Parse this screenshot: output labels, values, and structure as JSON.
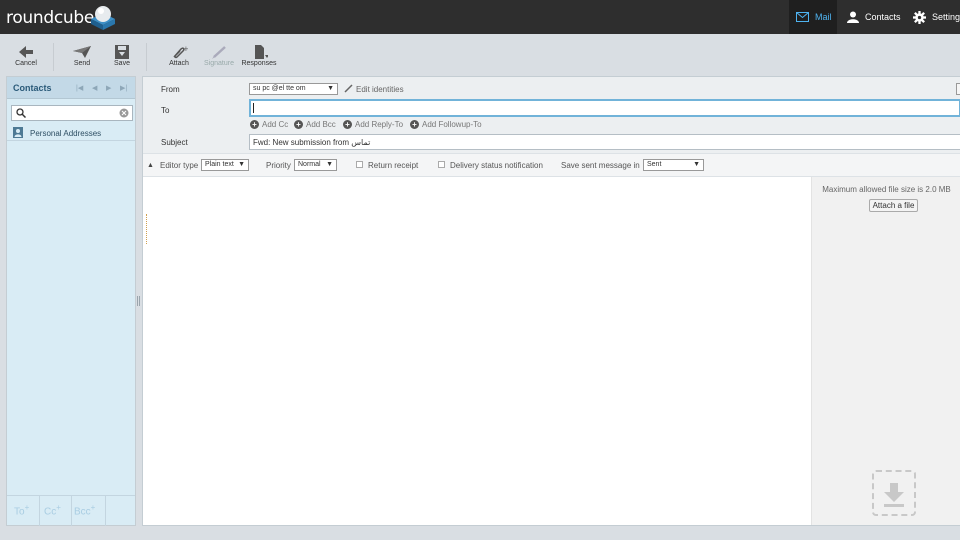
{
  "app": {
    "logo_text": "roundcube"
  },
  "topnav": {
    "mail": "Mail",
    "contacts": "Contacts",
    "settings": "Settings"
  },
  "toolbar": {
    "cancel": "Cancel",
    "send": "Send",
    "save": "Save",
    "attach": "Attach",
    "signature": "Signature",
    "responses": "Responses"
  },
  "contacts_panel": {
    "title": "Contacts",
    "search_placeholder": "",
    "items": [
      {
        "label": "Personal Addresses"
      }
    ],
    "footer": {
      "to": "To",
      "cc": "Cc",
      "bcc": "Bcc",
      "plus": "+"
    }
  },
  "compose": {
    "from_label": "From",
    "from_value": "su   pc  @el   tte   om",
    "edit_identities": "Edit identities",
    "to_label": "To",
    "to_value": "",
    "add_cc": "Add Cc",
    "add_bcc": "Add Bcc",
    "add_reply_to": "Add Reply-To",
    "add_followup_to": "Add Followup-To",
    "subject_label": "Subject",
    "subject_value": "Fwd: New submission from تماس"
  },
  "options": {
    "editor_type_label": "Editor type",
    "editor_type_value": "Plain text",
    "priority_label": "Priority",
    "priority_value": "Normal",
    "return_receipt": "Return receipt",
    "delivery_status": "Delivery status notification",
    "save_sent_label": "Save sent message in",
    "save_sent_value": "Sent"
  },
  "attachments": {
    "max_size": "Maximum allowed file size is 2.0 MB",
    "attach_button": "Attach a file"
  },
  "colors": {
    "accent": "#4fb3f0",
    "topbar": "#2e2e2e",
    "panel": "#d9ecf5"
  }
}
